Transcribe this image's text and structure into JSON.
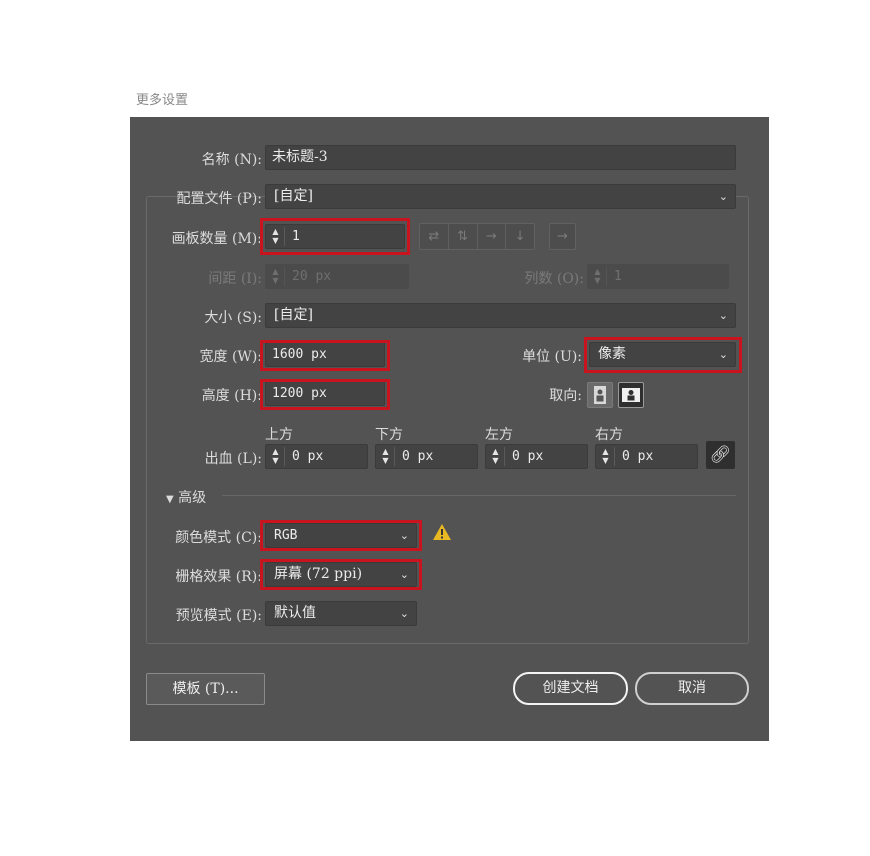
{
  "caption": "更多设置",
  "name": {
    "label": "名称 (N):",
    "value": "未标题-3"
  },
  "profile": {
    "label": "配置文件 (P):",
    "value": "[自定]"
  },
  "artboards": {
    "label": "画板数量 (M):",
    "value": "1",
    "spacing_label": "间距 (I):",
    "spacing_value": "20 px",
    "columns_label": "列数 (O):",
    "columns_value": "1"
  },
  "size": {
    "label": "大小 (S):",
    "value": "[自定]"
  },
  "width": {
    "label": "宽度 (W):",
    "value": "1600 px"
  },
  "units": {
    "label": "单位 (U):",
    "value": "像素"
  },
  "height": {
    "label": "高度 (H):",
    "value": "1200 px"
  },
  "orientation": {
    "label": "取向:",
    "options": [
      "portrait-icon",
      "landscape-icon"
    ],
    "selected": "landscape-icon"
  },
  "bleed": {
    "label": "出血 (L):",
    "headers": [
      "上方",
      "下方",
      "左方",
      "右方"
    ],
    "values": [
      "0 px",
      "0 px",
      "0 px",
      "0 px"
    ]
  },
  "advanced": {
    "label": "高级"
  },
  "color_mode": {
    "label": "颜色模式 (C):",
    "value": "RGB"
  },
  "raster": {
    "label": "栅格效果 (R):",
    "value": "屏幕 (72 ppi)"
  },
  "preview": {
    "label": "预览模式 (E):",
    "value": "默认值"
  },
  "buttons": {
    "templates": "模板 (T)...",
    "create": "创建文档",
    "cancel": "取消"
  },
  "colors": {
    "dialog_bg": "#535353",
    "highlight": "#c8141e",
    "warning": "#e8b923"
  }
}
